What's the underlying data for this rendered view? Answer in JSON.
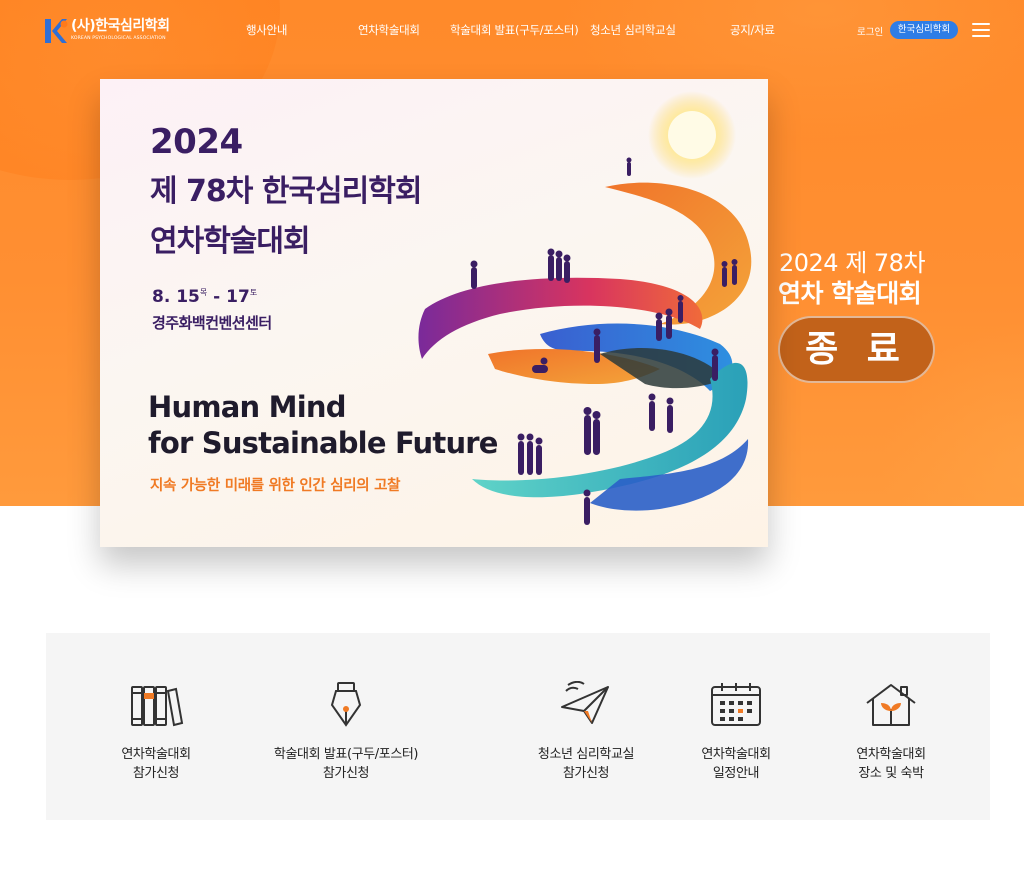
{
  "nav": {
    "logo_title": "(사)한국심리학회",
    "logo_subtitle": "KOREAN PSYCHOLOGICAL ASSOCIATION",
    "menu": [
      "행사안내",
      "연차학술대회",
      "학술대회 발표(구두/포스터)",
      "청소년 심리학교실",
      "공지/자료"
    ],
    "login": "로그인",
    "site_button": "한국심리학회"
  },
  "poster": {
    "year": "2024",
    "title_line1": "제 78차 한국심리학회",
    "title_line2": "연차학술대회",
    "date_start": "8. 15",
    "day_start": "목",
    "date_sep": " - ",
    "date_end": "17",
    "day_end": "토",
    "venue": "경주화백컨벤션센터",
    "english_line1": "Human Mind",
    "english_line2": "for Sustainable Future",
    "korean_subtitle": "지속 가능한 미래를 위한 인간 심리의 고찰"
  },
  "side": {
    "line1": "2024 제 78차",
    "line2": "연차 학술대회",
    "status_badge": "종 료"
  },
  "quick_links": [
    {
      "icon": "books-icon",
      "line1": "연차학술대회",
      "line2": "참가신청"
    },
    {
      "icon": "fountain-pen-icon",
      "line1": "학술대회 발표(구두/포스터)",
      "line2": "참가신청"
    },
    {
      "icon": "paper-plane-icon",
      "line1": "청소년 심리학교실",
      "line2": "참가신청"
    },
    {
      "icon": "calendar-icon",
      "line1": "연차학술대회",
      "line2": "일정안내"
    },
    {
      "icon": "house-plant-icon",
      "line1": "연차학술대회",
      "line2": "장소 및 숙박"
    }
  ],
  "colors": {
    "hero_orange": "#ff8f32",
    "poster_purple": "#3a1e63",
    "accent_orange": "#f07a24",
    "pill_blue": "#2f7de6",
    "badge_brown": "#c2621a"
  }
}
